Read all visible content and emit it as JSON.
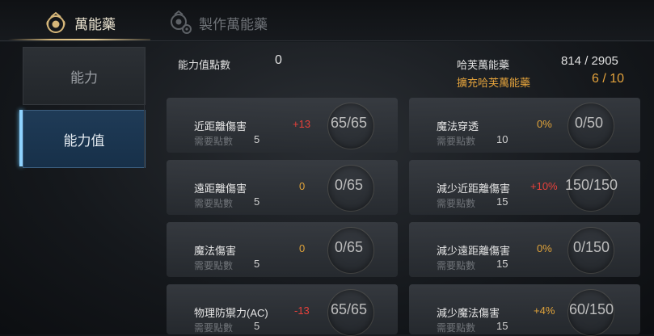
{
  "tabs": [
    {
      "label": "萬能藥",
      "icon": "potion-emblem-icon"
    },
    {
      "label": "製作萬能藥",
      "icon": "crafting-gear-icon"
    }
  ],
  "sidebar": [
    {
      "label": "能力"
    },
    {
      "label": "能力值"
    }
  ],
  "stat_points": {
    "label": "能力值點數",
    "value": "0"
  },
  "harufu": {
    "label": "哈芙萬能藥",
    "value": "814 / 2905",
    "expand_label": "擴充哈芙萬能藥",
    "expand_value": "6 / 10"
  },
  "req_label": "需要點數",
  "stats": [
    {
      "name": "近距離傷害",
      "bonus": "+13",
      "progress": "65/65",
      "req": "5",
      "bonus_color": "#e8413b"
    },
    {
      "name": "魔法穿透",
      "bonus": "0%",
      "progress": "0/50",
      "req": "10",
      "bonus_color": "#e0a33a"
    },
    {
      "name": "遠距離傷害",
      "bonus": "0",
      "progress": "0/65",
      "req": "5",
      "bonus_color": "#e0a33a"
    },
    {
      "name": "減少近距離傷害",
      "bonus": "+10%",
      "progress": "150/150",
      "req": "15",
      "bonus_color": "#e8413b"
    },
    {
      "name": "魔法傷害",
      "bonus": "0",
      "progress": "0/65",
      "req": "5",
      "bonus_color": "#e0a33a"
    },
    {
      "name": "減少遠距離傷害",
      "bonus": "0%",
      "progress": "0/150",
      "req": "15",
      "bonus_color": "#e0a33a"
    },
    {
      "name": "物理防禦力(AC)",
      "bonus": "-13",
      "progress": "65/65",
      "req": "5",
      "bonus_color": "#e8413b"
    },
    {
      "name": "減少魔法傷害",
      "bonus": "+4%",
      "progress": "60/150",
      "req": "15",
      "bonus_color": "#e0a33a"
    }
  ],
  "colors": {
    "accent_gold": "#d6b77a",
    "highlight_blue": "#8fd3ff"
  }
}
